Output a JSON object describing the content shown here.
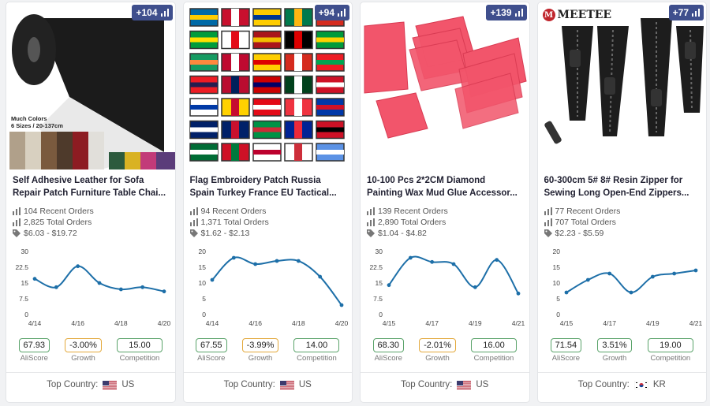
{
  "products": [
    {
      "badge": "+104",
      "title_line1": "Self Adhesive Leather for Sofa",
      "title_line2": "Repair Patch Furniture Table Chai...",
      "image_caption_1": "Much Colors",
      "image_caption_2": "6 Sizes / 20-137cm",
      "recent_orders": "104 Recent Orders",
      "total_orders": "2,825 Total Orders",
      "price_range": "$6.03 - $19.72",
      "aliscore": "67.93",
      "growth": "-3.00%",
      "competition": "15.00",
      "country_code": "US"
    },
    {
      "badge": "+94",
      "title_line1": "Flag Embroidery Patch Russia",
      "title_line2": "Spain Turkey France EU Tactical...",
      "recent_orders": "94 Recent Orders",
      "total_orders": "1,371 Total Orders",
      "price_range": "$1.62 - $2.13",
      "aliscore": "67.55",
      "growth": "-3.99%",
      "competition": "14.00",
      "country_code": "US"
    },
    {
      "badge": "+139",
      "title_line1": "10-100 Pcs 2*2CM Diamond",
      "title_line2": "Painting Wax Mud Glue Accessor...",
      "recent_orders": "139 Recent Orders",
      "total_orders": "2,890 Total Orders",
      "price_range": "$1.04 - $4.82",
      "aliscore": "68.30",
      "growth": "-2.01%",
      "competition": "16.00",
      "country_code": "US"
    },
    {
      "badge": "+77",
      "brand_logo": "MEETEE",
      "title_line1": "60-300cm 5# 8# Resin Zipper for",
      "title_line2": "Sewing Long Open-End Zippers...",
      "recent_orders": "77 Recent Orders",
      "total_orders": "707 Total Orders",
      "price_range": "$2.23 - $5.59",
      "aliscore": "71.54",
      "growth": "3.51%",
      "competition": "19.00",
      "country_code": "KR"
    }
  ],
  "labels": {
    "aliscore": "AliScore",
    "growth": "Growth",
    "competition": "Competition",
    "top_country": "Top Country:"
  },
  "chart_data": [
    {
      "type": "line",
      "x": [
        "4/14",
        "4/15",
        "4/16",
        "4/17",
        "4/18",
        "4/19",
        "4/20"
      ],
      "xticks": [
        "4/14",
        "4/16",
        "4/18",
        "4/20"
      ],
      "values": [
        17,
        13,
        23,
        15,
        12,
        13,
        11
      ],
      "yticks": [
        "30",
        "22.5",
        "15",
        "7.5",
        "0"
      ],
      "ylim": [
        0,
        30
      ],
      "color": "#1d6fa8"
    },
    {
      "type": "line",
      "x": [
        "4/14",
        "4/15",
        "4/16",
        "4/17",
        "4/18",
        "4/19",
        "4/20"
      ],
      "xticks": [
        "4/14",
        "4/16",
        "4/18",
        "4/20"
      ],
      "values": [
        11,
        18,
        16,
        17,
        17,
        12,
        3
      ],
      "yticks": [
        "20",
        "15",
        "10",
        "5",
        "0"
      ],
      "ylim": [
        0,
        20
      ],
      "color": "#1d6fa8"
    },
    {
      "type": "line",
      "x": [
        "4/15",
        "4/16",
        "4/17",
        "4/18",
        "4/19",
        "4/20",
        "4/21"
      ],
      "xticks": [
        "4/15",
        "4/17",
        "4/19",
        "4/21"
      ],
      "values": [
        14,
        27,
        25,
        24,
        13,
        26,
        10
      ],
      "yticks": [
        "30",
        "22.5",
        "15",
        "7.5",
        "0"
      ],
      "ylim": [
        0,
        30
      ],
      "color": "#1d6fa8"
    },
    {
      "type": "line",
      "x": [
        "4/15",
        "4/16",
        "4/17",
        "4/18",
        "4/19",
        "4/20",
        "4/21"
      ],
      "xticks": [
        "4/15",
        "4/17",
        "4/19",
        "4/21"
      ],
      "values": [
        7,
        11,
        13,
        7,
        12,
        13,
        14
      ],
      "yticks": [
        "20",
        "15",
        "10",
        "5",
        "0"
      ],
      "ylim": [
        0,
        20
      ],
      "color": "#1d6fa8"
    }
  ]
}
